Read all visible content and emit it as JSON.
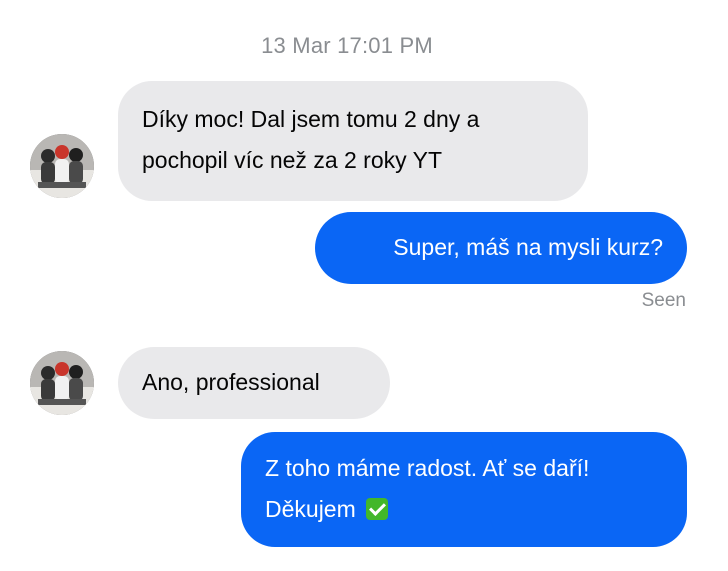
{
  "timestamp": "13 Mar 17:01 PM",
  "messages": [
    {
      "direction": "incoming",
      "lines": [
        "Díky moc! Dal jsem tomu 2 dny a",
        "pochopil víc než za 2 roky YT"
      ]
    },
    {
      "direction": "outgoing",
      "lines": [
        "Super, máš na mysli kurz?"
      ]
    },
    {
      "direction": "incoming",
      "lines": [
        "Ano, professional"
      ]
    },
    {
      "direction": "outgoing",
      "lines": [
        "Z toho máme radost. Ať se daří!",
        "Děkujem"
      ],
      "trailing_icon": "check-mark-emoji"
    }
  ],
  "seen_label": "Seen",
  "colors": {
    "incoming_bubble": "#e9e9eb",
    "outgoing_bubble": "#0a66f5",
    "meta_text": "#8a8d91"
  }
}
